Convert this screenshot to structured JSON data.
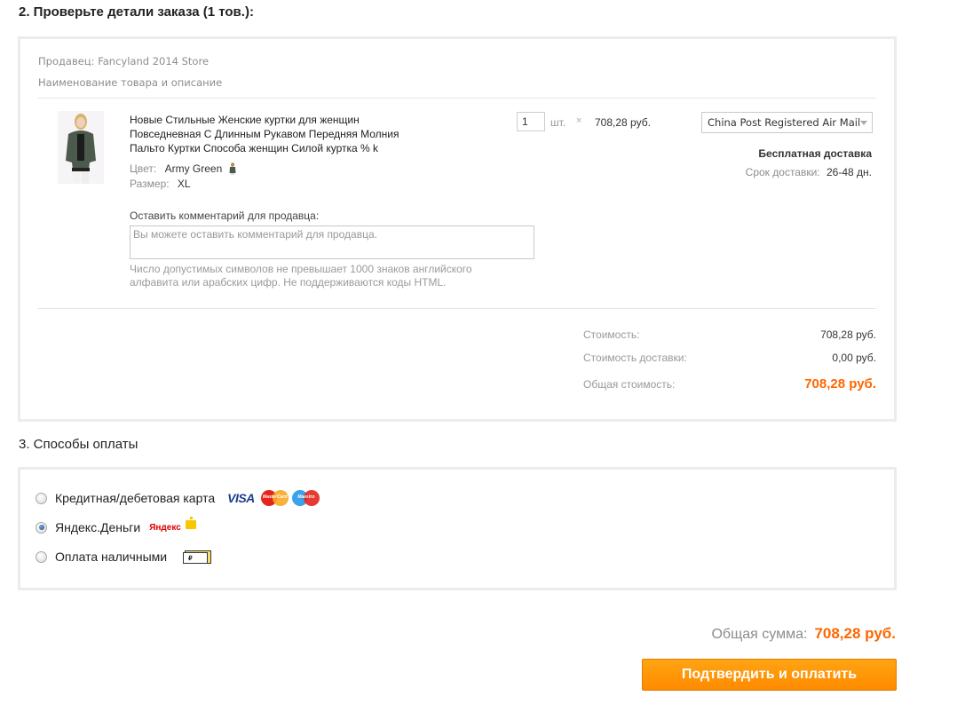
{
  "sections": {
    "order_title": "2. Проверьте детали заказа (1 тов.):",
    "payment_title": "3. Способы оплаты"
  },
  "order": {
    "seller": "Продавец: Fancyland 2014 Store",
    "column_header": "Наименование товара и описание",
    "product": {
      "title": "Новые Стильные Женские куртки для женщин Повседневная С Длинным Рукавом Передняя Молния Пальто Куртки Способа женщин Силой куртка % k",
      "color_label": "Цвет:",
      "color_value": "Army Green",
      "size_label": "Размер:",
      "size_value": "XL",
      "quantity": "1",
      "quantity_unit": "шт.",
      "times": "×",
      "unit_price": "708,28 руб."
    },
    "shipping": {
      "method": "China Post Registered Air Mail",
      "free_label": "Бесплатная доставка",
      "time_label": "Срок доставки:",
      "time_value": "26-48 дн."
    },
    "comment": {
      "label": "Оставить комментарий для продавца:",
      "placeholder": "Вы можете оставить комментарий для продавца.",
      "hint": "Число допустимых символов не превышает 1000 знаков английского алфавита или арабских цифр. Не поддерживаются коды HTML."
    },
    "summary": {
      "cost_label": "Стоимость:",
      "cost_value": "708,28 руб.",
      "shipping_label": "Стоимость доставки:",
      "shipping_value": "0,00 руб.",
      "total_label": "Общая стоимость:",
      "total_value": "708,28 руб."
    }
  },
  "payment": {
    "options": [
      {
        "label": "Кредитная/дебетовая карта",
        "selected": false,
        "icons": [
          "visa-logo",
          "mastercard-logo",
          "maestro-logo"
        ]
      },
      {
        "label": "Яндекс.Деньги",
        "selected": true,
        "icons": [
          "yandex-money-logo"
        ]
      },
      {
        "label": "Оплата наличными",
        "selected": false,
        "icons": [
          "cash-icon"
        ]
      }
    ],
    "visa_text": "VISA",
    "mastercard_text": "MasterCard",
    "maestro_text": "Maestro",
    "yandex_text": "Яндекс",
    "ruble_sign": "₽"
  },
  "footer": {
    "total_label": "Общая сумма:",
    "total_value": "708,28 руб.",
    "confirm_button": "Подтвердить и оплатить"
  },
  "colors": {
    "accent_orange": "#ff6600",
    "button_orange": "#ff9a0a",
    "border_grey": "#ececec"
  }
}
